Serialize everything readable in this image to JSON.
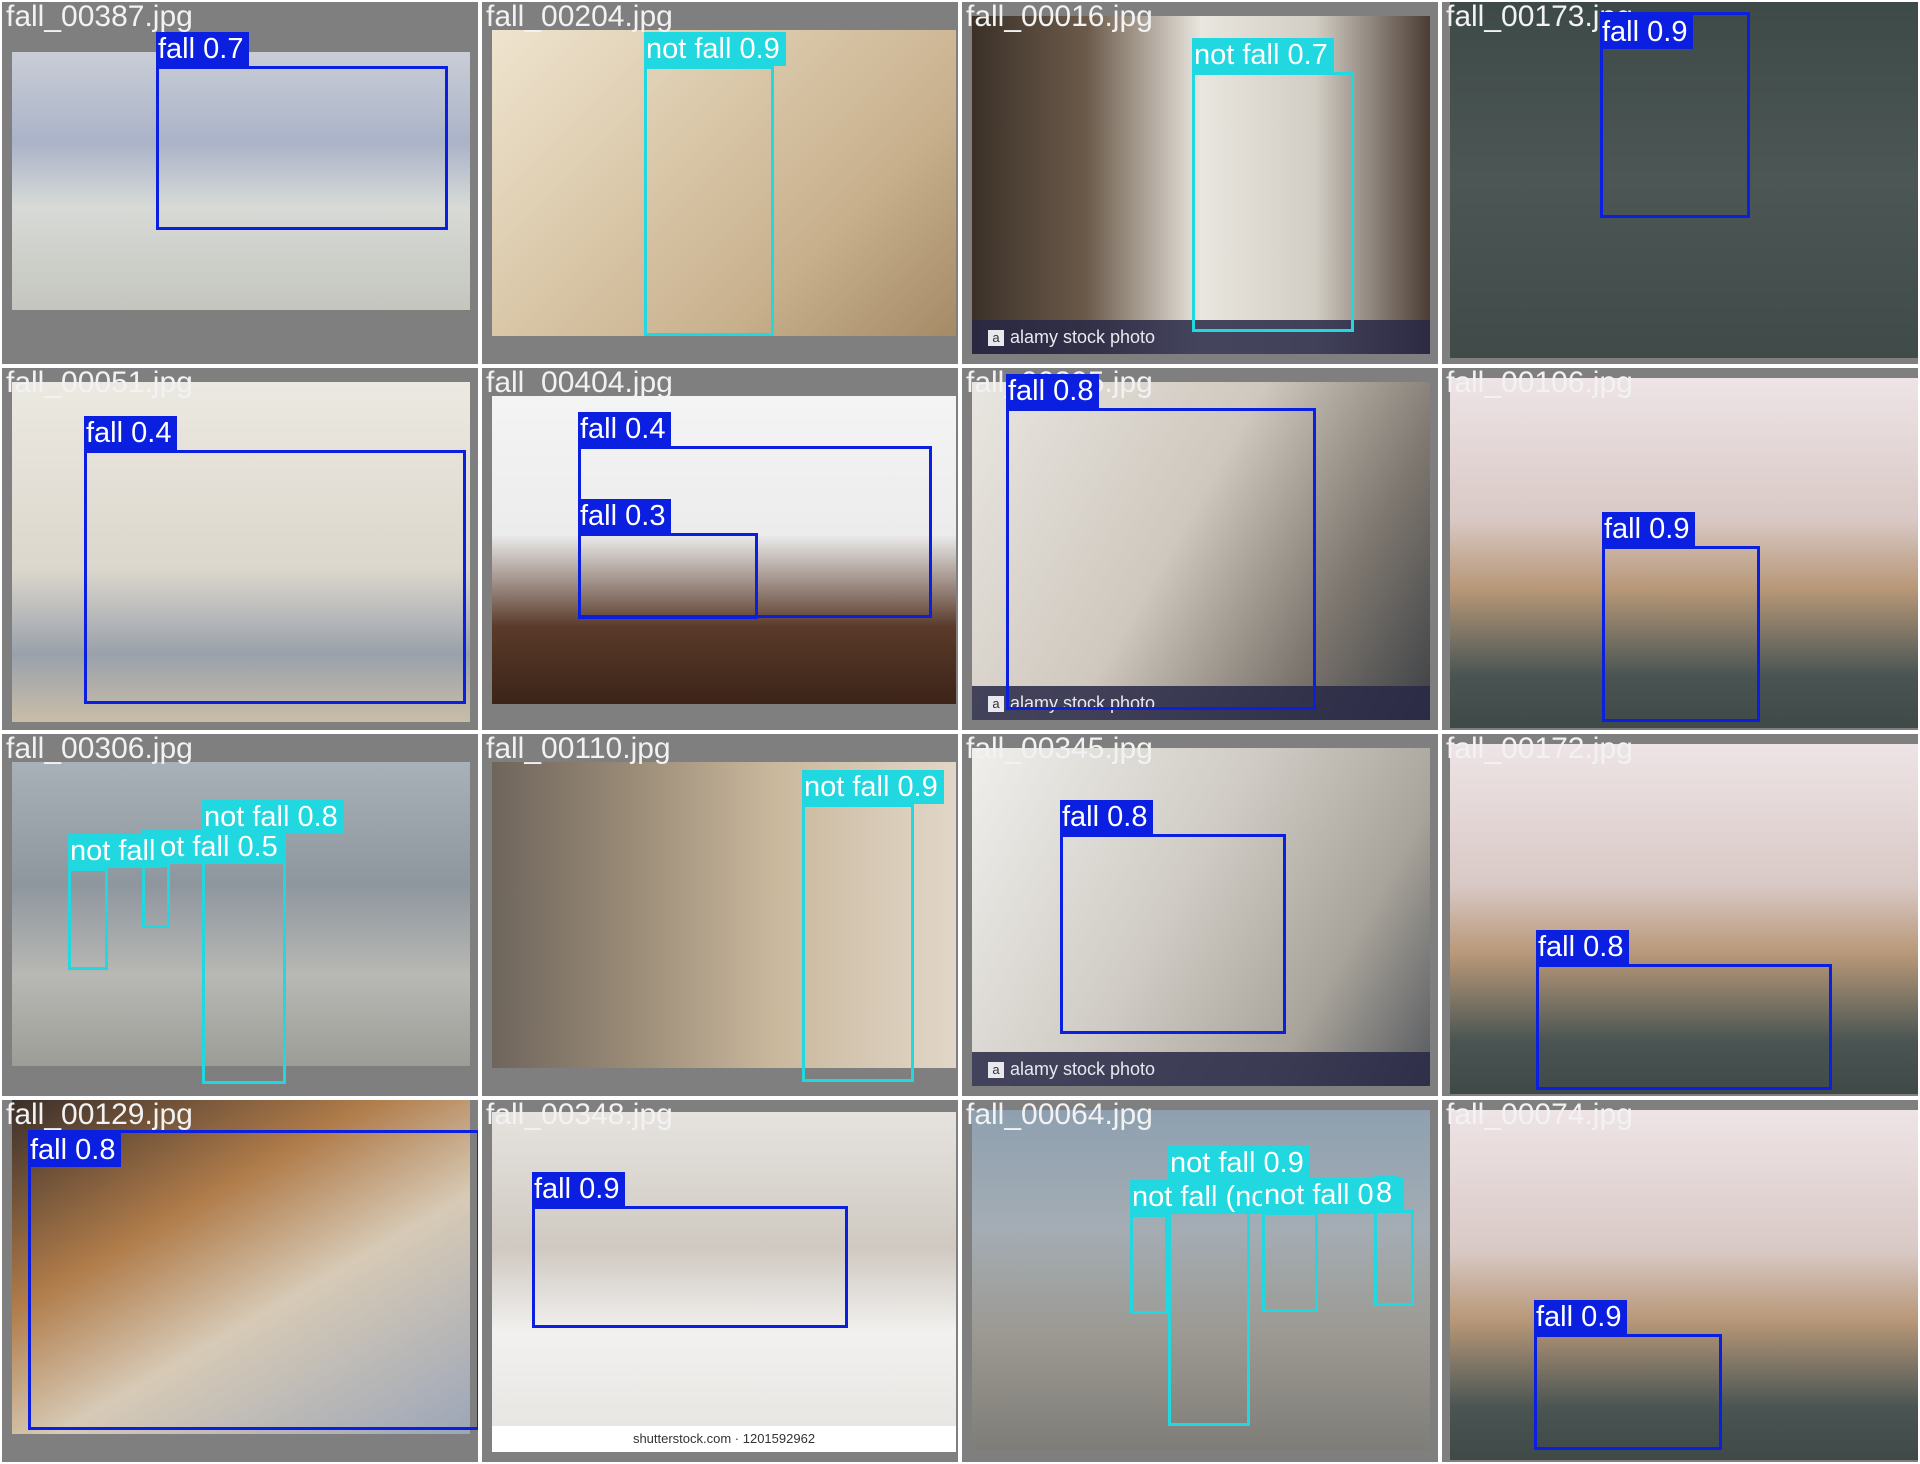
{
  "colors": {
    "fall": "#0b1fe0",
    "not_fall": "#21d7e0",
    "tile_background": "#7f7f7f"
  },
  "tiles": [
    {
      "filename": "fall_00387.jpg",
      "detections": [
        {
          "label": "fall 0.7",
          "cls": "fall"
        }
      ]
    },
    {
      "filename": "fall_00204.jpg",
      "detections": [
        {
          "label": "not fall 0.9",
          "cls": "not_fall"
        }
      ]
    },
    {
      "filename": "fall_00016.jpg",
      "watermark": "alamy stock photo",
      "detections": [
        {
          "label": "not fall 0.7",
          "cls": "not_fall"
        }
      ]
    },
    {
      "filename": "fall_00173.jpg",
      "detections": [
        {
          "label": "fall 0.9",
          "cls": "fall"
        }
      ]
    },
    {
      "filename": "fall_00051.jpg",
      "detections": [
        {
          "label": "fall 0.4",
          "cls": "fall"
        }
      ]
    },
    {
      "filename": "fall_00404.jpg",
      "detections": [
        {
          "label": "fall 0.4",
          "cls": "fall"
        },
        {
          "label": "fall 0.3",
          "cls": "fall"
        }
      ]
    },
    {
      "filename": "fall_00395.jpg",
      "watermark": "alamy stock photo",
      "detections": [
        {
          "label": "fall 0.8",
          "cls": "fall"
        }
      ]
    },
    {
      "filename": "fall_00106.jpg",
      "detections": [
        {
          "label": "fall 0.9",
          "cls": "fall"
        }
      ]
    },
    {
      "filename": "fall_00306.jpg",
      "detections": [
        {
          "label": "not fall 0.8",
          "cls": "not_fall"
        },
        {
          "label": "not fall 0.5",
          "cls": "not_fall"
        },
        {
          "label": "not fall",
          "cls": "not_fall"
        }
      ]
    },
    {
      "filename": "fall_00110.jpg",
      "detections": [
        {
          "label": "not fall 0.9",
          "cls": "not_fall"
        }
      ]
    },
    {
      "filename": "fall_00345.jpg",
      "watermark": "alamy stock photo",
      "detections": [
        {
          "label": "fall 0.8",
          "cls": "fall"
        }
      ]
    },
    {
      "filename": "fall_00172.jpg",
      "detections": [
        {
          "label": "fall 0.8",
          "cls": "fall"
        }
      ]
    },
    {
      "filename": "fall_00129.jpg",
      "detections": [
        {
          "label": "fall 0.8",
          "cls": "fall"
        }
      ]
    },
    {
      "filename": "fall_00348.jpg",
      "footer": "shutterstock.com · 1201592962",
      "detections": [
        {
          "label": "fall 0.9",
          "cls": "fall"
        }
      ]
    },
    {
      "filename": "fall_00064.jpg",
      "detections": [
        {
          "label": "not fall 0.9",
          "cls": "not_fall"
        },
        {
          "label": "not fall (not fall 0.4",
          "cls": "not_fall"
        },
        {
          "label": "not fall 0.4",
          "cls": "not_fall"
        },
        {
          "label": "8",
          "cls": "not_fall"
        }
      ]
    },
    {
      "filename": "fall_00074.jpg",
      "detections": [
        {
          "label": "fall 0.9",
          "cls": "fall"
        }
      ]
    }
  ]
}
